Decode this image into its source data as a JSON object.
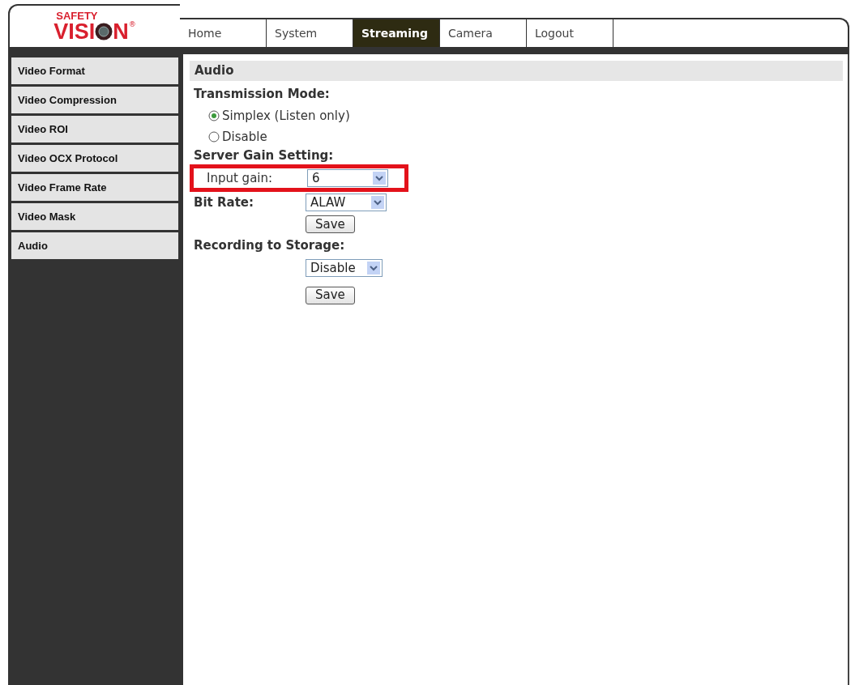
{
  "logo": {
    "top": "SAFETY",
    "main_left": "VISI",
    "main_right": "N",
    "mark": "®"
  },
  "tabs": [
    {
      "label": "Home",
      "selected": false
    },
    {
      "label": "System",
      "selected": false
    },
    {
      "label": "Streaming",
      "selected": true
    },
    {
      "label": "Camera",
      "selected": false
    },
    {
      "label": "Logout",
      "selected": false
    }
  ],
  "sidebar": {
    "items": [
      {
        "label": "Video Format",
        "selected": false
      },
      {
        "label": "Video Compression",
        "selected": false
      },
      {
        "label": "Video ROI",
        "selected": false
      },
      {
        "label": "Video OCX Protocol",
        "selected": false
      },
      {
        "label": "Video Frame Rate",
        "selected": false
      },
      {
        "label": "Video Mask",
        "selected": false
      },
      {
        "label": "Audio",
        "selected": false
      }
    ]
  },
  "content": {
    "title": "Audio",
    "transmission_mode": {
      "heading": "Transmission Mode:",
      "options": [
        {
          "label": "Simplex (Listen only)",
          "selected": true
        },
        {
          "label": "Disable",
          "selected": false
        }
      ]
    },
    "server_gain": {
      "heading": "Server Gain Setting:",
      "label": "Input gain:",
      "value": "6",
      "highlighted": true
    },
    "bit_rate": {
      "label": "Bit Rate:",
      "value": "ALAW"
    },
    "save_1": "Save",
    "recording": {
      "heading": "Recording to Storage:",
      "value": "Disable"
    },
    "save_2": "Save"
  }
}
